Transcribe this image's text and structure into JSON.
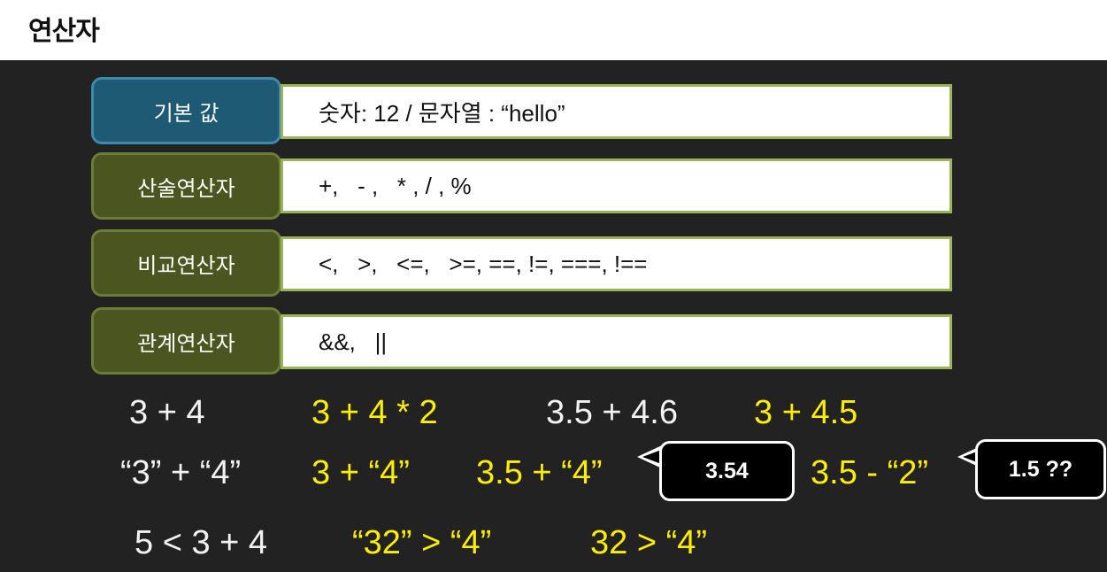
{
  "title": "연산자",
  "rows": [
    {
      "label": "기본 값",
      "content": "숫자: 12 / 문자열 : “hello”"
    },
    {
      "label": "산술연산자",
      "content": "+,   - ,   * , / , %"
    },
    {
      "label": "비교연산자",
      "content": "<,   >,   <=,   >=, ==, !=, ===, !=="
    },
    {
      "label": "관계연산자",
      "content": "&&,   ||"
    }
  ],
  "examples": {
    "line1": [
      "3 + 4",
      "3 + 4 * 2",
      "3.5 + 4.6",
      "3 + 4.5"
    ],
    "line2": [
      "“3” + “4”",
      "3 + “4”",
      "3.5 + “4”",
      "3.5 - “2”"
    ],
    "line3": [
      "5 < 3 + 4",
      "“32” > “4”",
      "32 > “4”"
    ]
  },
  "bubbles": {
    "first": "3.54",
    "second": "1.5 ??"
  },
  "colors": {
    "label_blue": "#1e5a74",
    "label_green": "#4a5520",
    "content_border": "#9bb35a",
    "highlight": "#ffee00",
    "background": "#222222"
  }
}
